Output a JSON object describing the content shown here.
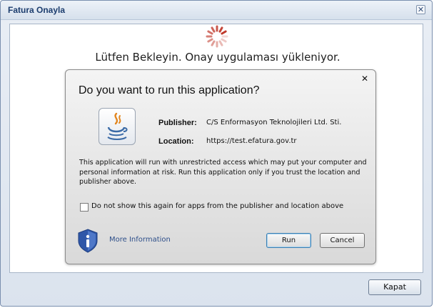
{
  "window": {
    "title": "Fatura Onayla",
    "close_glyph": "✕",
    "close_button_label": "Kapat"
  },
  "content": {
    "loading_text": "Lütfen Bekleyin. Onay uygulaması yükleniyor.",
    "spinner_icon": "spinner-icon"
  },
  "dialog": {
    "close_glyph": "✕",
    "title": "Do you want to run this application?",
    "app_icon": "java-icon",
    "publisher_label": "Publisher:",
    "publisher_value": "C/S Enformasyon Teknolojileri Ltd. Sti.",
    "location_label": "Location:",
    "location_value": "https://test.efatura.gov.tr",
    "warning_text": "This application will run with unrestricted access which may put your computer and personal information at risk. Run this application only if you trust the location and publisher above.",
    "checkbox_label": "Do not show this again for apps from the publisher and location above",
    "checkbox_checked": false,
    "shield_icon": "info-shield-icon",
    "more_info_label": "More Information",
    "run_label": "Run",
    "cancel_label": "Cancel"
  },
  "colors": {
    "title_text": "#1c3d6e",
    "link_text": "#2e4f8a",
    "spinner": "#c0392b",
    "shield": "#2f57a8"
  }
}
